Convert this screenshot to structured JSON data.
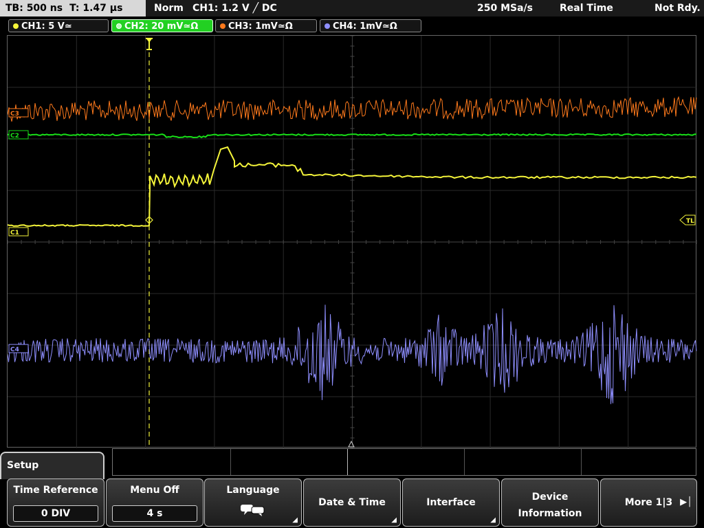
{
  "status": {
    "timebase": "TB: 500 ns",
    "trigger_time": "T: 1.47 µs",
    "mode": "Norm",
    "trigger": "CH1: 1.2 V ╱ DC",
    "sample_rate": "250 MSa/s",
    "acq_mode": "Real Time",
    "state": "Not Rdy."
  },
  "channels": [
    {
      "label": "CH1: 5 V≃",
      "color": "#f5f53a"
    },
    {
      "label": "CH2: 20 mV≃Ω",
      "color": "#18e018"
    },
    {
      "label": "CH3: 1mV≃Ω",
      "color": "#ff7a1c"
    },
    {
      "label": "CH4: 1mV≃Ω",
      "color": "#8f8fff"
    }
  ],
  "markers": {
    "c3": "C3",
    "c2": "C2",
    "c1": "C1",
    "c4": "C4",
    "tl": "TL"
  },
  "menu": {
    "title": "Setup",
    "keys": {
      "time_reference": {
        "label": "Time Reference",
        "value": "0 DIV"
      },
      "menu_off": {
        "label": "Menu Off",
        "value": "4 s"
      },
      "language": {
        "label": "Language",
        "icon": "speech-bubbles-icon"
      },
      "date_time": {
        "label": "Date & Time"
      },
      "interface": {
        "label": "Interface"
      },
      "device_info": {
        "line1": "Device",
        "line2": "Information"
      },
      "more": {
        "label": "More 1|3"
      }
    }
  }
}
